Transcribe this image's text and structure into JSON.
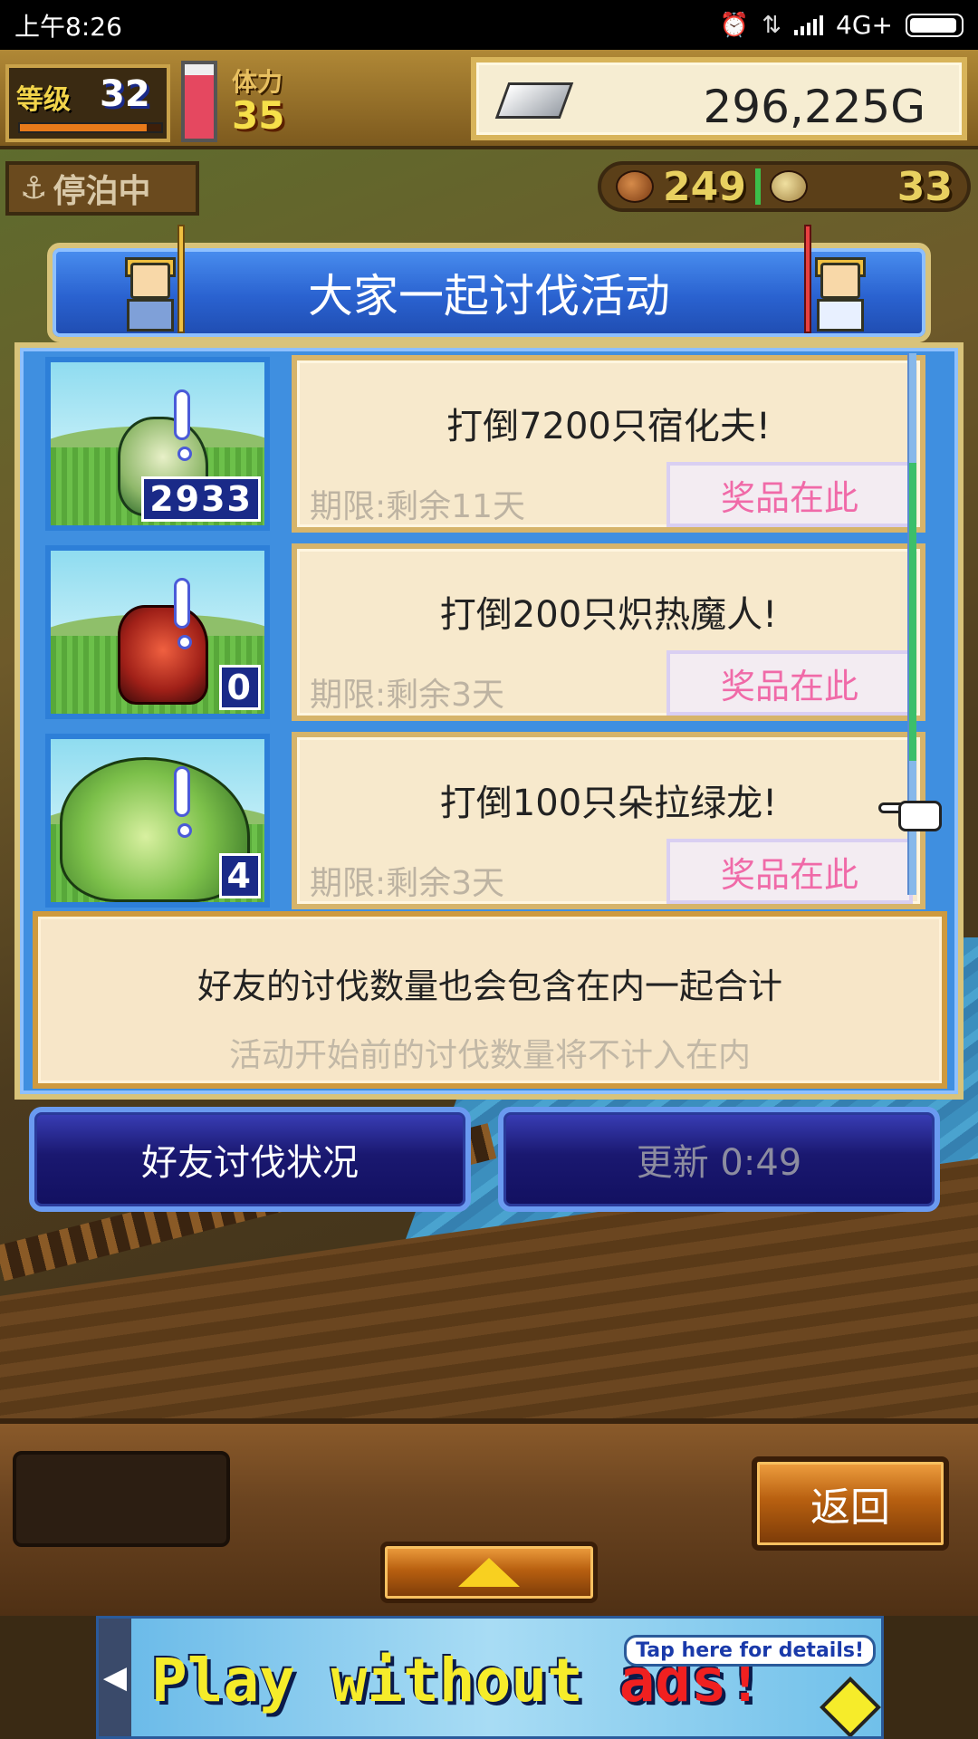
{
  "status_bar": {
    "time": "上午8:26",
    "network": "4G+",
    "icons": [
      "alarm-icon",
      "data-arrows-icon",
      "signal-icon",
      "battery-icon"
    ]
  },
  "hud": {
    "level_label": "等级",
    "level": "32",
    "level_progress": 0.9,
    "stamina_label": "体力",
    "stamina": "35",
    "stamina_gauge": 0.85,
    "gold": "296,225G",
    "status": "停泊中",
    "food": "249",
    "medals": "33"
  },
  "event": {
    "title": "大家一起讨伐活动",
    "quests": [
      {
        "text": "打倒7200只宿化夫!",
        "deadline": "期限:剩余11天",
        "prize_label": "奖品在此",
        "count": "2933",
        "monster": "shell-monster"
      },
      {
        "text": "打倒200只炽热魔人!",
        "deadline": "期限:剩余3天",
        "prize_label": "奖品在此",
        "count": "0",
        "monster": "fire-demon"
      },
      {
        "text": "打倒100只朵拉绿龙!",
        "deadline": "期限:剩余3天",
        "prize_label": "奖品在此",
        "count": "4",
        "monster": "green-dragon"
      }
    ],
    "scroll_position": 0.45,
    "scroll_visible_fraction": 0.55,
    "info_main": "好友的讨伐数量也会包含在内一起合计",
    "info_sub": "活动开始前的讨伐数量将不计入在内"
  },
  "buttons": {
    "friends_status": "好友讨伐状况",
    "refresh": "更新 0:49",
    "back": "返回"
  },
  "ad": {
    "text_part1": "Play without ",
    "text_part2": "ads!",
    "tip": "Tap here for details!"
  },
  "colors": {
    "panel_blue": "#3f8fe0",
    "card_bg": "#f7e9cc",
    "prize_pink": "#f06aa8",
    "button_navy": "#1a1870"
  }
}
